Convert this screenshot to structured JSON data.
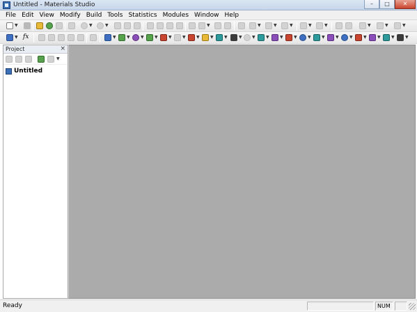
{
  "window": {
    "title": "Untitled - Materials Studio",
    "controls": {
      "minimize": "–",
      "maximize": "□",
      "close": "✕"
    }
  },
  "menu": {
    "items": [
      "File",
      "Edit",
      "View",
      "Modify",
      "Build",
      "Tools",
      "Statistics",
      "Modules",
      "Window",
      "Help"
    ]
  },
  "toolbar": {
    "formula_label": "fx"
  },
  "project": {
    "title": "Project",
    "close": "×",
    "tree": [
      {
        "label": "Untitled",
        "icon": "project-document-icon"
      }
    ]
  },
  "statusbar": {
    "status": "Ready",
    "num": "NUM"
  },
  "colors": {
    "workspace": "#ababab",
    "titlebar": "#c6d6ea",
    "close": "#c9452e"
  }
}
